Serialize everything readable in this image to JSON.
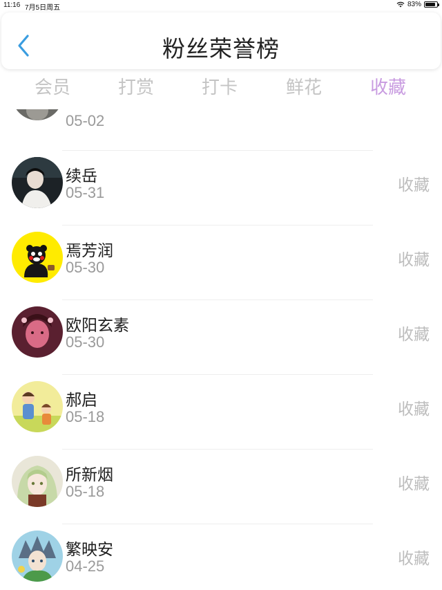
{
  "status_bar": {
    "time": "11:16",
    "date": "7月5日周五",
    "battery": "83%"
  },
  "header": {
    "title": "粉丝荣誉榜"
  },
  "tabs": [
    {
      "label": "会员",
      "active": false
    },
    {
      "label": "打赏",
      "active": false
    },
    {
      "label": "打卡",
      "active": false
    },
    {
      "label": "鲜花",
      "active": false
    },
    {
      "label": "收藏",
      "active": true
    }
  ],
  "colors": {
    "accent_blue": "#3a9de0",
    "tab_active": "#c89be0",
    "tab_inactive": "#c4c4c4"
  },
  "list": {
    "partial_top_date": "05-02",
    "items": [
      {
        "name": "续岳",
        "date": "05-31",
        "action": "收藏",
        "avatar": "dark-portrait-avatar"
      },
      {
        "name": "焉芳润",
        "date": "05-30",
        "action": "收藏",
        "avatar": "bear-mascot-avatar"
      },
      {
        "name": "欧阳玄素",
        "date": "05-30",
        "action": "收藏",
        "avatar": "pink-girl-avatar"
      },
      {
        "name": "郝启",
        "date": "05-18",
        "action": "收藏",
        "avatar": "cartoon-kids-avatar"
      },
      {
        "name": "所新烟",
        "date": "05-18",
        "action": "收藏",
        "avatar": "anime-girl-avatar"
      },
      {
        "name": "繁映安",
        "date": "04-25",
        "action": "收藏",
        "avatar": "anime-boy-avatar"
      }
    ]
  }
}
